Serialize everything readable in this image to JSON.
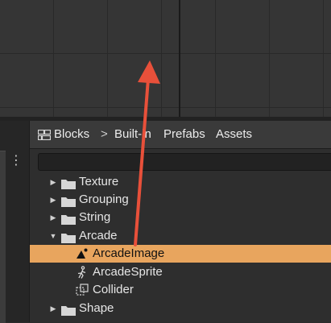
{
  "colors": {
    "selection": "#e8a55e",
    "annotation_arrow": "#e8503a"
  },
  "blocks_panel": {
    "breadcrumb": {
      "root": "Blocks",
      "separator": ">",
      "tabs": [
        "Built-in",
        "Prefabs",
        "Assets"
      ]
    },
    "search": {
      "value": "",
      "placeholder": ""
    },
    "tree": {
      "texture": "Texture",
      "grouping": "Grouping",
      "string": "String",
      "arcade": "Arcade",
      "arcade_image": "ArcadeImage",
      "arcade_sprite": "ArcadeSprite",
      "collider": "Collider",
      "shape": "Shape"
    }
  },
  "icons": {
    "blocks": "blocks-icon",
    "folder": "folder-icon",
    "arcade_image": "arcade-image-icon",
    "arcade_sprite": "arcade-sprite-icon",
    "collider": "collider-icon",
    "menu": "kebab-menu-icon"
  }
}
